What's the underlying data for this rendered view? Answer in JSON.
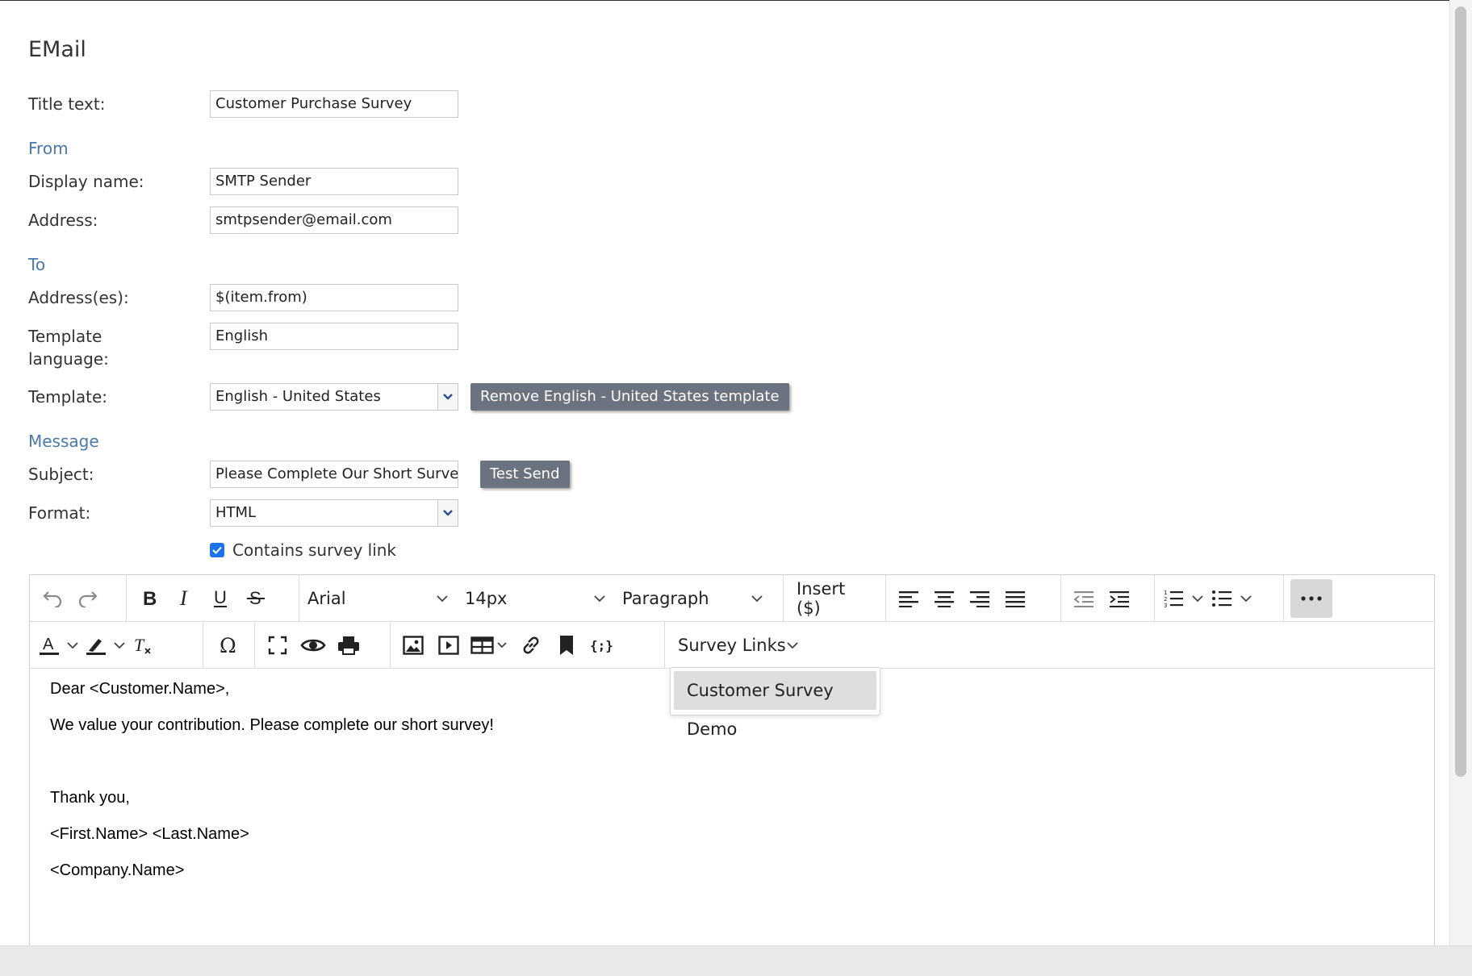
{
  "page": {
    "title": "EMail"
  },
  "sections": {
    "from": "From",
    "to": "To",
    "message": "Message"
  },
  "fields": {
    "title_text": {
      "label": "Title text:",
      "value": "Customer Purchase Survey"
    },
    "display_name": {
      "label": "Display name:",
      "value": "SMTP Sender"
    },
    "address": {
      "label": "Address:",
      "value": "smtpsender@email.com"
    },
    "addresses": {
      "label": "Address(es):",
      "value": "$(item.from)"
    },
    "template_language": {
      "label_line1": "Template",
      "label_line2": "language:",
      "value": "English"
    },
    "template": {
      "label": "Template:",
      "value": "English - United States",
      "remove_label": "Remove English - United States template"
    },
    "subject": {
      "label": "Subject:",
      "value": "Please Complete Our Short Survey",
      "test_send_label": "Test Send"
    },
    "format": {
      "label": "Format:",
      "value": "HTML"
    },
    "survey_link": {
      "label": "Contains survey link",
      "checked": true
    }
  },
  "toolbar": {
    "font_family": "Arial",
    "font_size": "14px",
    "block_format": "Paragraph",
    "insert_label": "Insert ($)",
    "survey_links_label": "Survey Links",
    "icons": [
      "undo-icon",
      "redo-icon",
      "bold-icon",
      "italic-icon",
      "underline-icon",
      "strikethrough-icon",
      "align-left-icon",
      "align-center-icon",
      "align-right-icon",
      "justify-icon",
      "outdent-icon",
      "indent-icon",
      "numbered-list-icon",
      "bullet-list-icon",
      "more-icon",
      "text-color-icon",
      "highlight-icon",
      "clear-format-icon",
      "special-char-icon",
      "fullscreen-icon",
      "preview-icon",
      "print-icon",
      "image-icon",
      "media-icon",
      "table-icon",
      "link-icon",
      "bookmark-icon",
      "code-icon"
    ]
  },
  "survey_menu": {
    "items": [
      "Customer Survey Demo"
    ]
  },
  "editor_content": {
    "greeting": "Dear <Customer.Name>,",
    "body": "We value your contribution. Please complete our short survey!",
    "closing": "Thank you,",
    "signature_name": "<First.Name> <Last.Name>",
    "signature_company": "<Company.Name>"
  },
  "colors": {
    "accent": "#1a73e8",
    "section": "#4a78a8",
    "button": "#6c7380"
  }
}
